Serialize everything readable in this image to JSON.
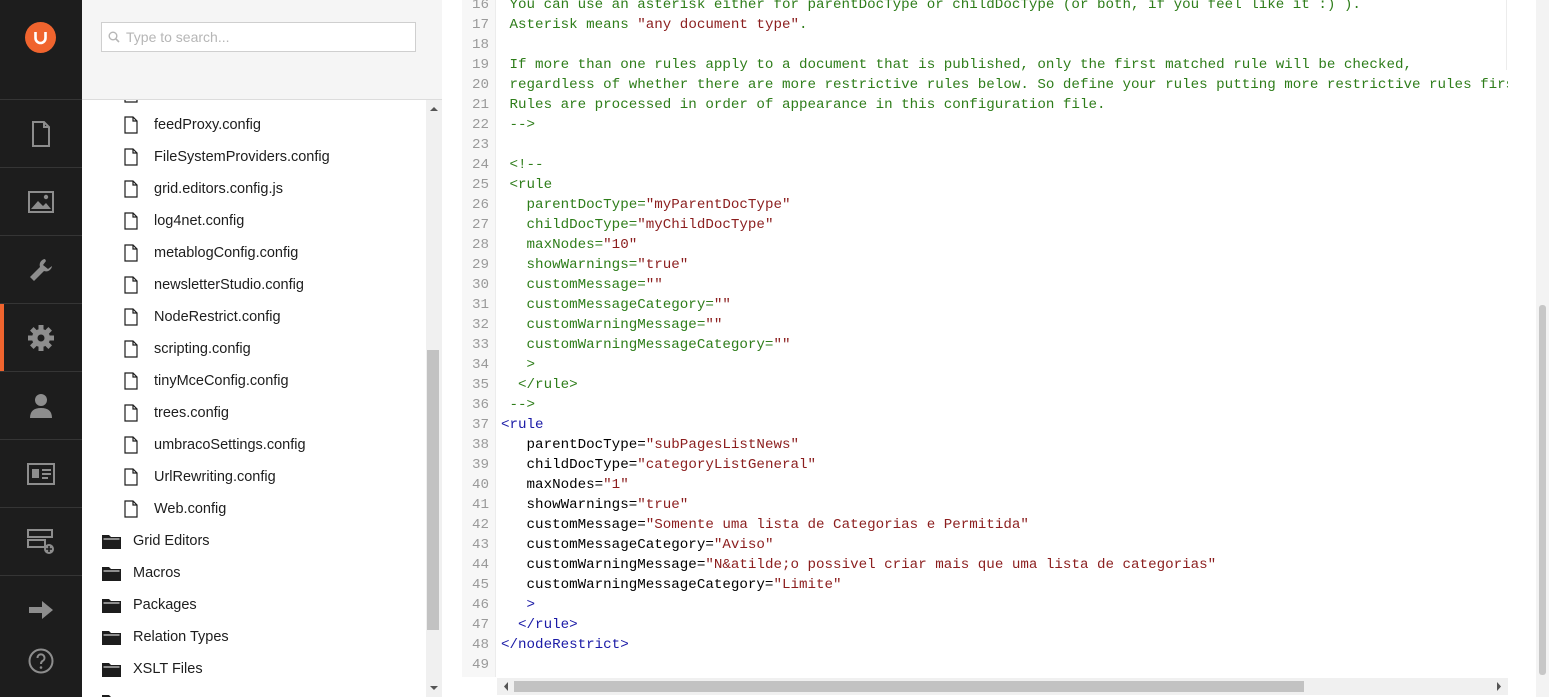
{
  "search": {
    "placeholder": "Type to search..."
  },
  "rail": {
    "items": [
      {
        "name": "content",
        "icon": "document-icon"
      },
      {
        "name": "media",
        "icon": "image-icon"
      },
      {
        "name": "developer",
        "icon": "wrench-icon"
      },
      {
        "name": "settings",
        "icon": "gear-icon",
        "active": true
      },
      {
        "name": "users",
        "icon": "user-icon"
      },
      {
        "name": "members",
        "icon": "id-card-icon"
      },
      {
        "name": "forms",
        "icon": "form-add-icon"
      },
      {
        "name": "redirect",
        "icon": "arrow-right-icon"
      },
      {
        "name": "help",
        "icon": "help-icon"
      }
    ],
    "accent_color": "#f0642e"
  },
  "tree": {
    "files": [
      "feedProxy.config",
      "FileSystemProviders.config",
      "grid.editors.config.js",
      "log4net.config",
      "metablogConfig.config",
      "newsletterStudio.config",
      "NodeRestrict.config",
      "scripting.config",
      "tinyMceConfig.config",
      "trees.config",
      "umbracoSettings.config",
      "UrlRewriting.config",
      "Web.config"
    ],
    "folders": [
      "Grid Editors",
      "Macros",
      "Packages",
      "Relation Types",
      "XSLT Files"
    ]
  },
  "editor": {
    "lines": [
      {
        "n": "16",
        "parts": [
          [
            "c-comment-green",
            " You can use an asterisk either for parentDocType or childDocType (or both, if you feel like it :) )."
          ]
        ]
      },
      {
        "n": "17",
        "parts": [
          [
            "c-comment-green",
            " Asterisk means "
          ],
          [
            "c-str",
            "\"any document type\""
          ],
          [
            "c-comment-green",
            "."
          ]
        ]
      },
      {
        "n": "18",
        "parts": []
      },
      {
        "n": "19",
        "parts": [
          [
            "c-comment-green",
            " If more than one rules apply to a document that is published, only the first matched rule will be checked,"
          ]
        ]
      },
      {
        "n": "20",
        "parts": [
          [
            "c-comment-green",
            " regardless of whether there are more restrictive rules below. So define your rules putting more restrictive rules first."
          ]
        ]
      },
      {
        "n": "21",
        "parts": [
          [
            "c-comment-green",
            " Rules are processed in order of appearance in this configuration file."
          ]
        ]
      },
      {
        "n": "22",
        "parts": [
          [
            "c-comment-green",
            " -->"
          ]
        ]
      },
      {
        "n": "23",
        "parts": []
      },
      {
        "n": "24",
        "parts": [
          [
            "c-comment-green",
            " <!--"
          ]
        ]
      },
      {
        "n": "25",
        "parts": [
          [
            "c-comment-green",
            " <rule"
          ]
        ]
      },
      {
        "n": "26",
        "parts": [
          [
            "c-comment-green",
            "   parentDocType="
          ],
          [
            "c-str",
            "\"myParentDocType\""
          ]
        ]
      },
      {
        "n": "27",
        "parts": [
          [
            "c-comment-green",
            "   childDocType="
          ],
          [
            "c-str",
            "\"myChildDocType\""
          ]
        ]
      },
      {
        "n": "28",
        "parts": [
          [
            "c-comment-green",
            "   maxNodes="
          ],
          [
            "c-str",
            "\"10\""
          ]
        ]
      },
      {
        "n": "29",
        "parts": [
          [
            "c-comment-green",
            "   showWarnings="
          ],
          [
            "c-str",
            "\"true\""
          ]
        ]
      },
      {
        "n": "30",
        "parts": [
          [
            "c-comment-green",
            "   customMessage="
          ],
          [
            "c-str",
            "\"\""
          ]
        ]
      },
      {
        "n": "31",
        "parts": [
          [
            "c-comment-green",
            "   customMessageCategory="
          ],
          [
            "c-str",
            "\"\""
          ]
        ]
      },
      {
        "n": "32",
        "parts": [
          [
            "c-comment-green",
            "   customWarningMessage="
          ],
          [
            "c-str",
            "\"\""
          ]
        ]
      },
      {
        "n": "33",
        "parts": [
          [
            "c-comment-green",
            "   customWarningMessageCategory="
          ],
          [
            "c-str",
            "\"\""
          ]
        ]
      },
      {
        "n": "34",
        "parts": [
          [
            "c-comment-green",
            "   >"
          ]
        ]
      },
      {
        "n": "35",
        "parts": [
          [
            "c-comment-green",
            "  </rule>"
          ]
        ]
      },
      {
        "n": "36",
        "parts": [
          [
            "c-comment-green",
            " -->"
          ]
        ]
      },
      {
        "n": "37",
        "parts": [
          [
            "c-tag",
            "<rule"
          ]
        ]
      },
      {
        "n": "38",
        "parts": [
          [
            "c-attr",
            "   parentDocType="
          ],
          [
            "c-str",
            "\"subPagesListNews\""
          ]
        ]
      },
      {
        "n": "39",
        "parts": [
          [
            "c-attr",
            "   childDocType="
          ],
          [
            "c-str",
            "\"categoryListGeneral\""
          ]
        ]
      },
      {
        "n": "40",
        "parts": [
          [
            "c-attr",
            "   maxNodes="
          ],
          [
            "c-str",
            "\"1\""
          ]
        ]
      },
      {
        "n": "41",
        "parts": [
          [
            "c-attr",
            "   showWarnings="
          ],
          [
            "c-str",
            "\"true\""
          ]
        ]
      },
      {
        "n": "42",
        "parts": [
          [
            "c-attr",
            "   customMessage="
          ],
          [
            "c-str",
            "\"Somente uma lista de Categorias e Permitida\""
          ]
        ]
      },
      {
        "n": "43",
        "parts": [
          [
            "c-attr",
            "   customMessageCategory="
          ],
          [
            "c-str",
            "\"Aviso\""
          ]
        ]
      },
      {
        "n": "44",
        "parts": [
          [
            "c-attr",
            "   customWarningMessage="
          ],
          [
            "c-str",
            "\"N&atilde;o possivel criar mais que uma lista de categorias\""
          ]
        ]
      },
      {
        "n": "45",
        "parts": [
          [
            "c-attr",
            "   customWarningMessageCategory="
          ],
          [
            "c-str",
            "\"Limite\""
          ]
        ]
      },
      {
        "n": "46",
        "parts": [
          [
            "c-tag",
            "   >"
          ]
        ]
      },
      {
        "n": "47",
        "parts": [
          [
            "c-tag",
            "  </rule>"
          ]
        ]
      },
      {
        "n": "48",
        "parts": [
          [
            "c-tag",
            "</nodeRestrict>"
          ]
        ]
      },
      {
        "n": "49",
        "parts": []
      }
    ]
  }
}
